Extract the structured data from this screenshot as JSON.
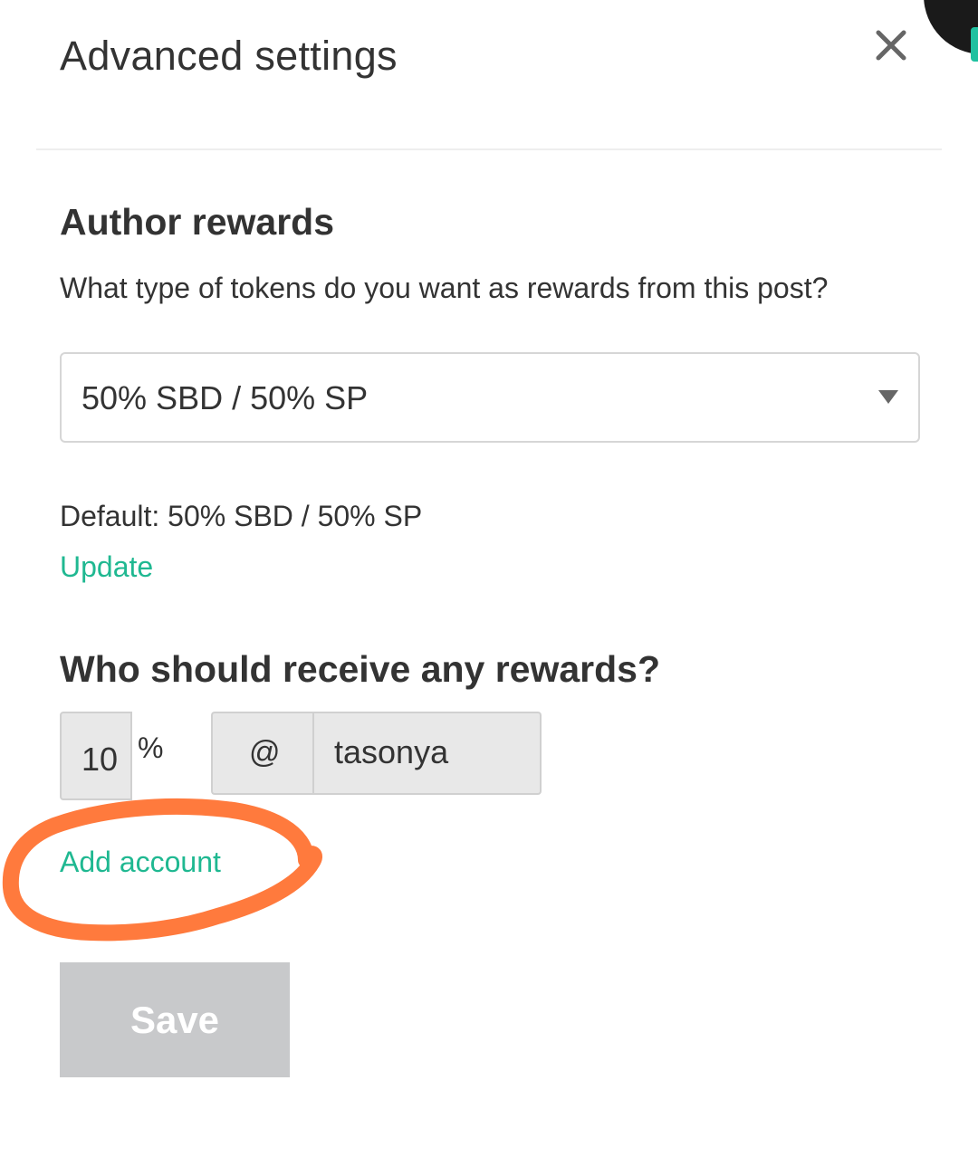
{
  "dialog": {
    "title": "Advanced settings",
    "close_icon": "close-icon"
  },
  "author_rewards": {
    "heading": "Author rewards",
    "question": "What type of tokens do you want as rewards from this post?",
    "selected_value": "50% SBD / 50% SP",
    "default_text": "Default: 50% SBD / 50% SP",
    "update_link": "Update"
  },
  "beneficiaries": {
    "heading": "Who should receive any rewards?",
    "percent_value": "10",
    "percent_sign": "%",
    "at_symbol": "@",
    "account_value": "tasonya",
    "add_account_link": "Add account"
  },
  "save_button": {
    "label": "Save"
  },
  "colors": {
    "accent_link": "#1fb891",
    "annotation_stroke": "#ff7a3d",
    "save_disabled_bg": "#c8c9cb"
  }
}
